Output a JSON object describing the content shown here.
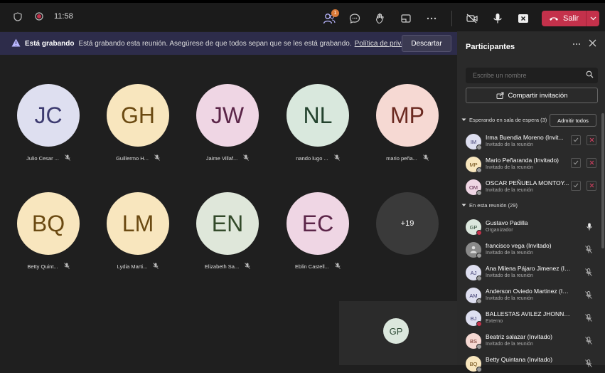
{
  "titlebar": {
    "time": "11:58",
    "participants_badge": "1",
    "leave_label": "Salir"
  },
  "banner": {
    "strong": "Está grabando",
    "text": "Está grabando esta reunión. Asegúrese de que todos sepan que se les está grabando.",
    "link": "Política de privacidad",
    "discard": "Descartar"
  },
  "tiles": [
    {
      "initials": "JC",
      "name": "Julio Cesar ...",
      "bg": "#dedff0",
      "fg": "#3d3b70"
    },
    {
      "initials": "GH",
      "name": "Guillermo H...",
      "bg": "#f8e6be",
      "fg": "#6b4a12"
    },
    {
      "initials": "JW",
      "name": "Jaime Villaf...",
      "bg": "#efd6e4",
      "fg": "#5b2548"
    },
    {
      "initials": "NL",
      "name": "nando lugo ...",
      "bg": "#d9e8dd",
      "fg": "#24432e"
    },
    {
      "initials": "MP",
      "name": "mario peña...",
      "bg": "#f6d9d3",
      "fg": "#6b2a21"
    },
    {
      "initials": "BQ",
      "name": "Betty Quint...",
      "bg": "#f8e6be",
      "fg": "#6b4a12"
    },
    {
      "initials": "LM",
      "name": "Lydia Marti...",
      "bg": "#f8e6be",
      "fg": "#6b4a12"
    },
    {
      "initials": "EN",
      "name": "Elizabeth Sa...",
      "bg": "#dfe7da",
      "fg": "#334a2a"
    },
    {
      "initials": "EC",
      "name": "Eblin Castell...",
      "bg": "#efd6e4",
      "fg": "#5b2548"
    }
  ],
  "overflow": "+19",
  "self_initials": "GP",
  "panel": {
    "title": "Participantes",
    "search_placeholder": "Escribe un nombre",
    "share": "Compartir invitación",
    "waiting_label": "Esperando en sala de espera (3)",
    "admit_all": "Admitir todos",
    "in_meeting_label": "En esta reunión (29)",
    "waiting": [
      {
        "initials": "IM",
        "name": "Irma Buendia Moreno (Invit...",
        "role": "Invitado de la reunión",
        "bg": "#dedff0",
        "fg": "#3d3b70",
        "dot": "#999999"
      },
      {
        "initials": "MP",
        "name": "Mario Peñaranda (Invitado)",
        "role": "Invitado de la reunión",
        "bg": "#f8e6be",
        "fg": "#6b4a12",
        "dot": "#999999"
      },
      {
        "initials": "OM",
        "name": "OSCAR PEÑUELA MONTOY...",
        "role": "Invitado de la reunión",
        "bg": "#efd6e4",
        "fg": "#5b2548",
        "dot": "#999999"
      }
    ],
    "members": [
      {
        "initials": "GP",
        "name": "Gustavo Padilla",
        "role": "Organizador",
        "bg": "#dbe7dd",
        "fg": "#2d4a35",
        "dot": "#c4314b",
        "mic": "on"
      },
      {
        "initials": "",
        "name": "francisco vega (Invitado)",
        "role": "Invitado de la reunión",
        "bg": "#8a8a8a",
        "fg": "#ffffff",
        "dot": "#999999",
        "mic": "off"
      },
      {
        "initials": "AJ",
        "name": "Ana Milena Pájaro Jimenez (Invit...",
        "role": "Invitado de la reunión",
        "bg": "#dedff0",
        "fg": "#3d3b70",
        "dot": "#999999",
        "mic": "off"
      },
      {
        "initials": "AM",
        "name": "Anderson Oviedo Martinez (Invit...",
        "role": "Invitado de la reunión",
        "bg": "#dedff0",
        "fg": "#3d3b70",
        "dot": "#999999",
        "mic": "off"
      },
      {
        "initials": "BJ",
        "name": "BALLESTAS AVILEZ JHONNATAN",
        "role": "Externo",
        "bg": "#dedff0",
        "fg": "#3d3b70",
        "dot": "#c4314b",
        "mic": "off"
      },
      {
        "initials": "BS",
        "name": "Beatriz salazar (Invitado)",
        "role": "Invitado de la reunión",
        "bg": "#f6d9d3",
        "fg": "#6b2a21",
        "dot": "#999999",
        "mic": "off"
      },
      {
        "initials": "BQ",
        "name": "Betty Quintana (Invitado)",
        "role": "",
        "bg": "#f8e6be",
        "fg": "#6b4a12",
        "dot": "#999999",
        "mic": "off"
      }
    ]
  }
}
